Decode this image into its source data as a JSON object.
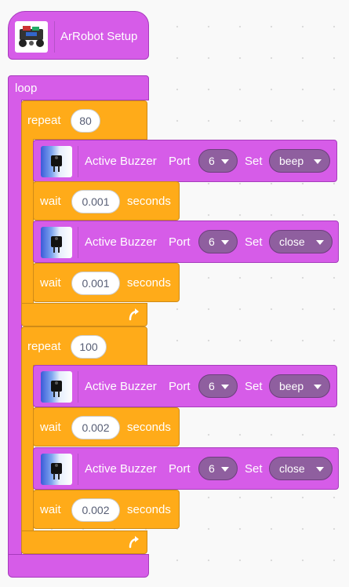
{
  "setup": {
    "label": "ArRobot Setup",
    "icon": "robot-image-icon"
  },
  "loop": {
    "label": "loop"
  },
  "repeat1": {
    "label": "repeat",
    "count": "80",
    "buzzer1": {
      "title": "Active Buzzer",
      "port_label": "Port",
      "port": "6",
      "set_label": "Set",
      "value": "beep"
    },
    "wait1": {
      "label": "wait",
      "value": "0.001",
      "unit": "seconds"
    },
    "buzzer2": {
      "title": "Active Buzzer",
      "port_label": "Port",
      "port": "6",
      "set_label": "Set",
      "value": "close"
    },
    "wait2": {
      "label": "wait",
      "value": "0.001",
      "unit": "seconds"
    }
  },
  "repeat2": {
    "label": "repeat",
    "count": "100",
    "buzzer1": {
      "title": "Active Buzzer",
      "port_label": "Port",
      "port": "6",
      "set_label": "Set",
      "value": "beep"
    },
    "wait1": {
      "label": "wait",
      "value": "0.002",
      "unit": "seconds"
    },
    "buzzer2": {
      "title": "Active Buzzer",
      "port_label": "Port",
      "port": "6",
      "set_label": "Set",
      "value": "close"
    },
    "wait2": {
      "label": "wait",
      "value": "0.002",
      "unit": "seconds"
    }
  },
  "colors": {
    "looks_purple": "#d65ce8",
    "control_orange": "#ffab19",
    "dropdown": "#8f5f9f"
  }
}
